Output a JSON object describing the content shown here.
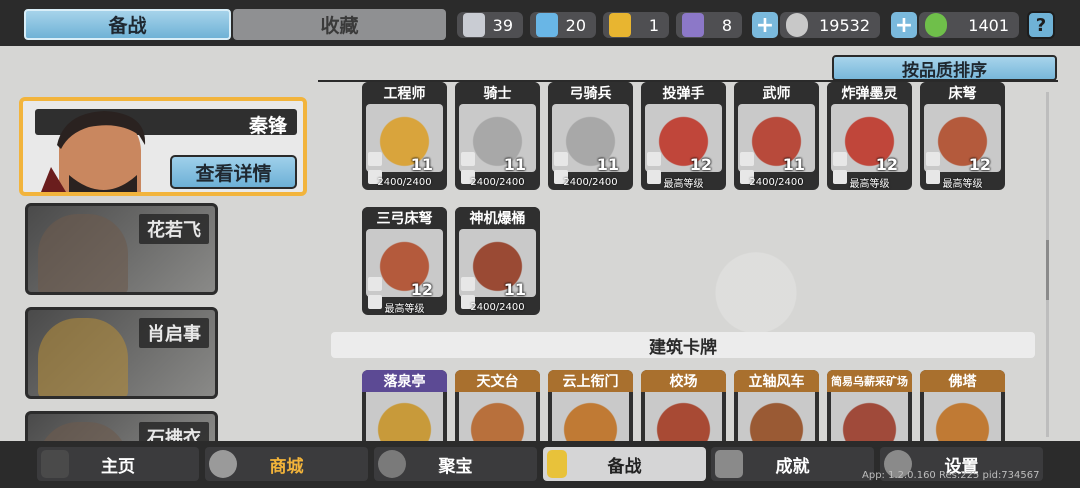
{
  "tabs": {
    "active": "备战",
    "inactive": "收藏"
  },
  "resources": [
    {
      "icon": "silver-shield-icon",
      "value": "39"
    },
    {
      "icon": "blue-shield-icon",
      "value": "20"
    },
    {
      "icon": "gold-shield-icon",
      "value": "1"
    },
    {
      "icon": "purple-shield-icon",
      "value": "8"
    },
    {
      "icon": "silver-coin-icon",
      "value": "19532"
    },
    {
      "icon": "green-gem-icon",
      "value": "1401"
    }
  ],
  "help_label": "?",
  "heroes": {
    "selected": {
      "name": "秦锋",
      "detail_label": "查看详情"
    },
    "others": [
      "花若飞",
      "肖启事",
      "石拂衣"
    ]
  },
  "sort_label": "按品质排序",
  "unit_cards": [
    {
      "title": "工程师",
      "level": "11",
      "sub": "2400/2400",
      "title_color": "#2f2f2f",
      "art_color": "#d9a43c"
    },
    {
      "title": "骑士",
      "level": "11",
      "sub": "2400/2400",
      "title_color": "#2f2f2f",
      "art_color": "#a8a8a8"
    },
    {
      "title": "弓骑兵",
      "level": "11",
      "sub": "2400/2400",
      "title_color": "#2f2f2f",
      "art_color": "#a8a8a8"
    },
    {
      "title": "投弹手",
      "level": "12",
      "sub": "最高等级",
      "title_color": "#2f2f2f",
      "art_color": "#c0463a"
    },
    {
      "title": "武师",
      "level": "11",
      "sub": "2400/2400",
      "title_color": "#2f2f2f",
      "art_color": "#b84a3b"
    },
    {
      "title": "炸弹墨灵",
      "level": "12",
      "sub": "最高等级",
      "title_color": "#2f2f2f",
      "art_color": "#c0463a"
    },
    {
      "title": "床弩",
      "level": "12",
      "sub": "最高等级",
      "title_color": "#2f2f2f",
      "art_color": "#b45a3c"
    },
    {
      "title": "三弓床弩",
      "level": "12",
      "sub": "最高等级",
      "title_color": "#2f2f2f",
      "art_color": "#b45a3c"
    },
    {
      "title": "神机爆桶",
      "level": "11",
      "sub": "2400/2400",
      "title_color": "#2f2f2f",
      "art_color": "#9a4a34"
    }
  ],
  "section_title": "建筑卡牌",
  "building_cards": [
    {
      "title": "落泉亭",
      "title_color": "#5c4a94",
      "art_color": "#c89a3a"
    },
    {
      "title": "天文台",
      "title_color": "#a9702e",
      "art_color": "#b8703c"
    },
    {
      "title": "云上衔门",
      "title_color": "#a9702e",
      "art_color": "#c07a34"
    },
    {
      "title": "校场",
      "title_color": "#a9702e",
      "art_color": "#a84a34"
    },
    {
      "title": "立轴风车",
      "title_color": "#a9702e",
      "art_color": "#9a5a34"
    },
    {
      "title": "简易乌薪采矿场",
      "title_color": "#a9702e",
      "art_color": "#a04a3a"
    },
    {
      "title": "佛塔",
      "title_color": "#a9702e",
      "art_color": "#c07a34"
    }
  ],
  "nav": [
    {
      "label": "主页",
      "icon": "castle-icon"
    },
    {
      "label": "商城",
      "icon": "coins-icon"
    },
    {
      "label": "聚宝",
      "icon": "treasure-bowl-icon"
    },
    {
      "label": "备战",
      "icon": "card-icon"
    },
    {
      "label": "成就",
      "icon": "achievement-icon"
    },
    {
      "label": "设置",
      "icon": "gear-icon"
    }
  ],
  "version_text": "App: 1.2.0.160 Res:225 pid:734567"
}
